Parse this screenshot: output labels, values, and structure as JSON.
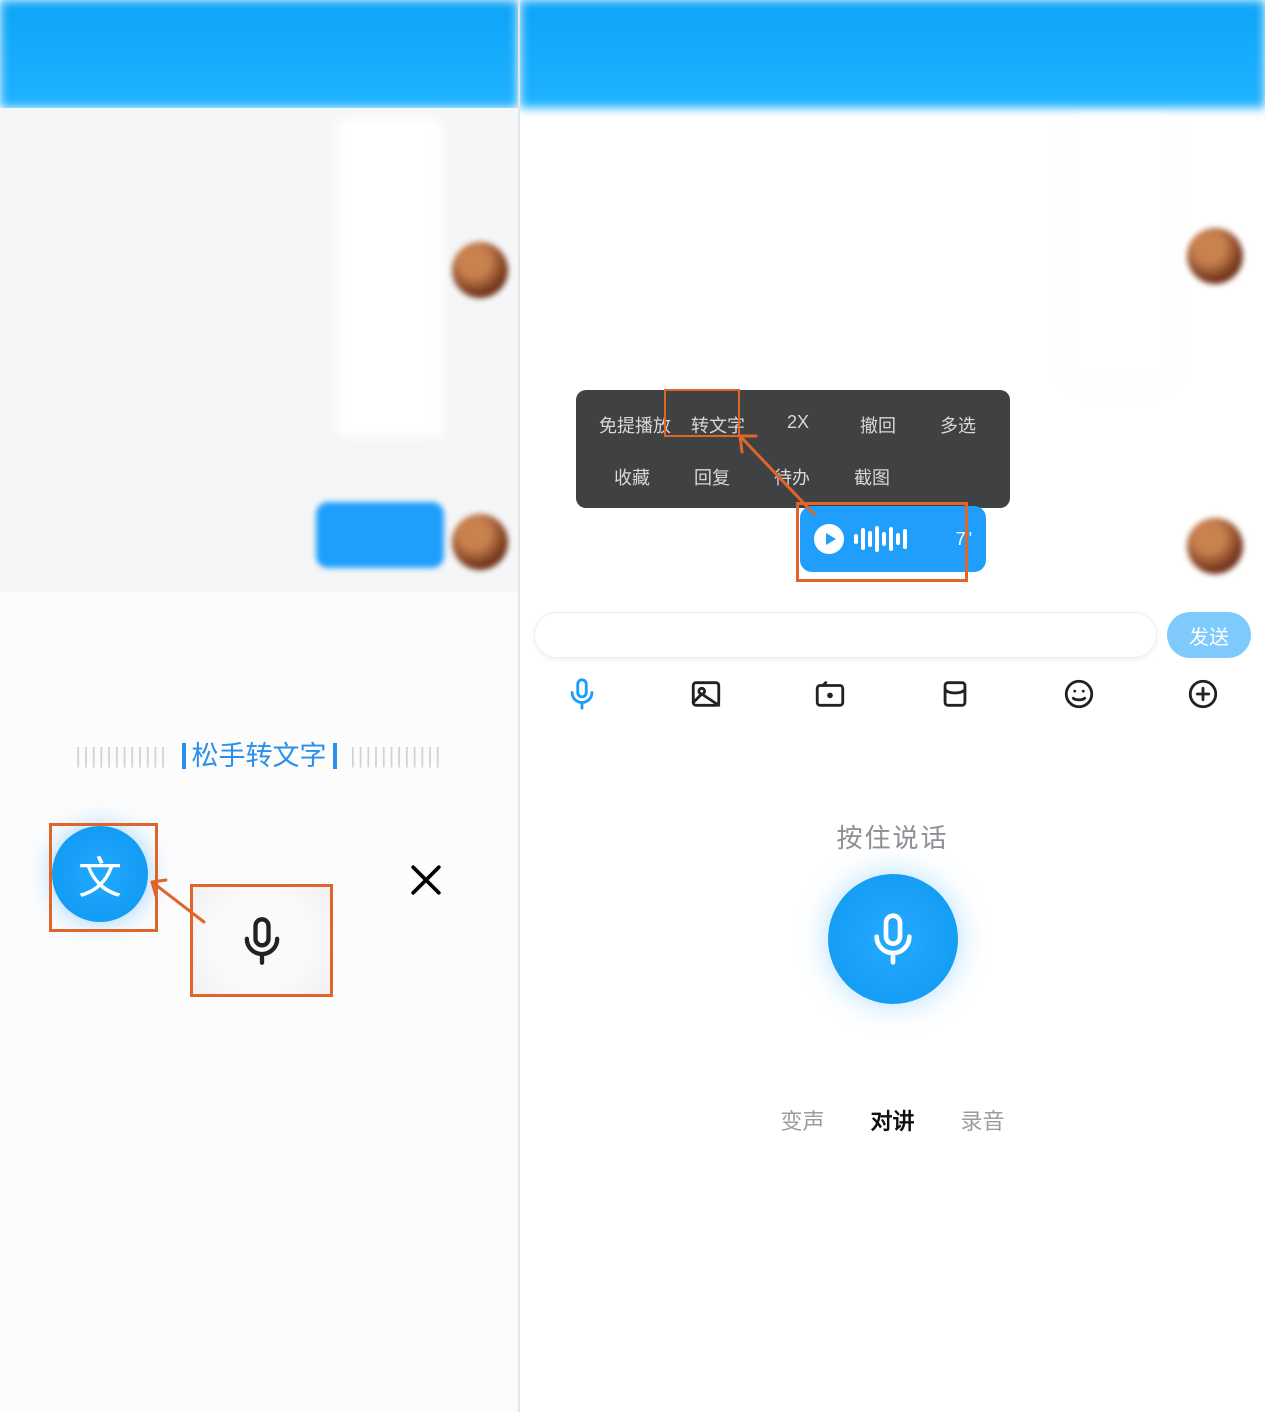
{
  "left": {
    "hint": "松手转文字",
    "wen_label": "文"
  },
  "right": {
    "menu": {
      "row1": [
        "免提播放",
        "转文字",
        "2X",
        "撤回",
        "多选"
      ],
      "row2": [
        "收藏",
        "回复",
        "待办",
        "截图"
      ]
    },
    "voice_duration": "7\"",
    "send_label": "发送",
    "hold_label": "按住说话",
    "modes": {
      "a": "变声",
      "b": "对讲",
      "c": "录音"
    }
  }
}
